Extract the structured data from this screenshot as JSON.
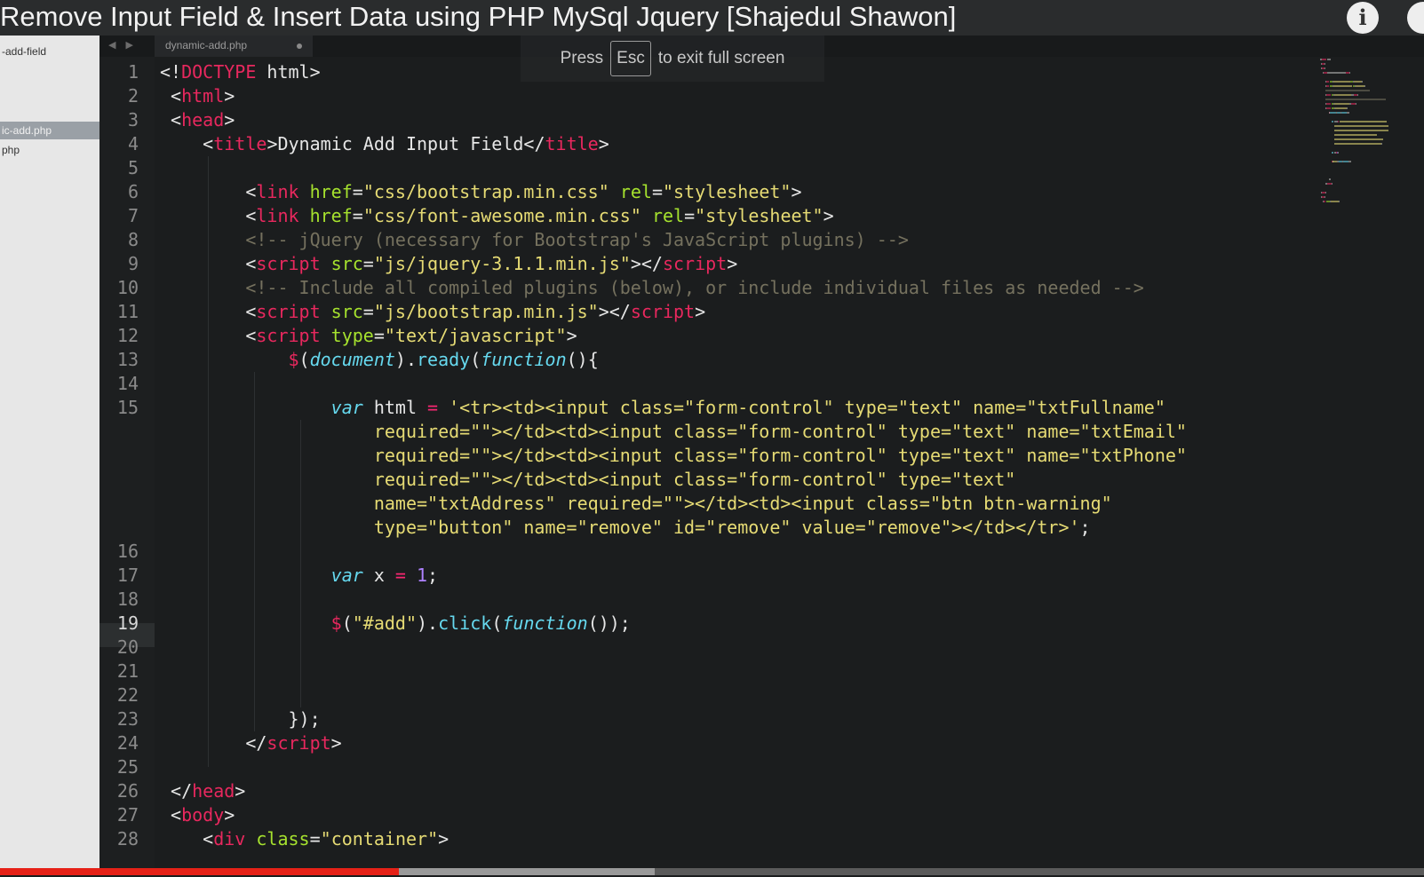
{
  "video": {
    "title": "Remove Input Field & Insert Data using PHP MySql Jquery [Shajedul Shawon]",
    "info_icon": "info-icon",
    "played_fraction": 0.28,
    "buffered_fraction": 0.46,
    "progress_color": "#e62117"
  },
  "fullscreen_toast": {
    "press": "Press",
    "key": "Esc",
    "rest": "to exit full screen"
  },
  "sidebar": {
    "items": [
      {
        "label": "-add-field",
        "selected": false
      },
      {
        "label": "ic-add.php",
        "selected": true
      },
      {
        "label": "php",
        "selected": false
      }
    ]
  },
  "editor": {
    "nav_arrows": "◀ ▶",
    "tab_label": "dynamic-add.php",
    "current_line": "19",
    "theme_colors": {
      "tag": "#e8285e",
      "string": "#e6db74",
      "attribute": "#a6e22e",
      "keyword": "#66d9ef",
      "comment": "#75715e"
    },
    "line_numbers": [
      "1",
      "2",
      "3",
      "4",
      "5",
      "6",
      "7",
      "8",
      "9",
      "10",
      "11",
      "12",
      "13",
      "14",
      "15",
      "",
      "",
      "",
      "",
      "",
      "16",
      "17",
      "18",
      "19",
      "20",
      "21",
      "22",
      "23",
      "24",
      "25",
      "26",
      "27",
      "28"
    ],
    "lines": [
      [
        {
          "t": "<!",
          "c": ""
        },
        {
          "t": "DOCTYPE",
          "c": "tag"
        },
        {
          "t": " html>",
          "c": ""
        }
      ],
      [
        {
          "t": " <",
          "c": ""
        },
        {
          "t": "html",
          "c": "tag"
        },
        {
          "t": ">",
          "c": ""
        }
      ],
      [
        {
          "t": " <",
          "c": ""
        },
        {
          "t": "head",
          "c": "tag"
        },
        {
          "t": ">",
          "c": ""
        }
      ],
      [
        {
          "t": "    <",
          "c": ""
        },
        {
          "t": "title",
          "c": "tag"
        },
        {
          "t": ">Dynamic Add Input Field</",
          "c": ""
        },
        {
          "t": "title",
          "c": "tag"
        },
        {
          "t": ">",
          "c": ""
        }
      ],
      [],
      [
        {
          "t": "        <",
          "c": ""
        },
        {
          "t": "link",
          "c": "tag"
        },
        {
          "t": " ",
          "c": ""
        },
        {
          "t": "href",
          "c": "attr"
        },
        {
          "t": "=",
          "c": ""
        },
        {
          "t": "\"css/bootstrap.min.css\"",
          "c": "str"
        },
        {
          "t": " ",
          "c": ""
        },
        {
          "t": "rel",
          "c": "attr"
        },
        {
          "t": "=",
          "c": ""
        },
        {
          "t": "\"stylesheet\"",
          "c": "str"
        },
        {
          "t": ">",
          "c": ""
        }
      ],
      [
        {
          "t": "        <",
          "c": ""
        },
        {
          "t": "link",
          "c": "tag"
        },
        {
          "t": " ",
          "c": ""
        },
        {
          "t": "href",
          "c": "attr"
        },
        {
          "t": "=",
          "c": ""
        },
        {
          "t": "\"css/font-awesome.min.css\"",
          "c": "str"
        },
        {
          "t": " ",
          "c": ""
        },
        {
          "t": "rel",
          "c": "attr"
        },
        {
          "t": "=",
          "c": ""
        },
        {
          "t": "\"stylesheet\"",
          "c": "str"
        },
        {
          "t": ">",
          "c": ""
        }
      ],
      [
        {
          "t": "        <!-- jQuery (necessary for Bootstrap's JavaScript plugins) -->",
          "c": "com"
        }
      ],
      [
        {
          "t": "        <",
          "c": ""
        },
        {
          "t": "script",
          "c": "tag"
        },
        {
          "t": " ",
          "c": ""
        },
        {
          "t": "src",
          "c": "attr"
        },
        {
          "t": "=",
          "c": ""
        },
        {
          "t": "\"js/jquery-3.1.1.min.js\"",
          "c": "str"
        },
        {
          "t": "></",
          "c": ""
        },
        {
          "t": "script",
          "c": "tag"
        },
        {
          "t": ">",
          "c": ""
        }
      ],
      [
        {
          "t": "        <!-- Include all compiled plugins (below), or include individual files as needed -->",
          "c": "com"
        }
      ],
      [
        {
          "t": "        <",
          "c": ""
        },
        {
          "t": "script",
          "c": "tag"
        },
        {
          "t": " ",
          "c": ""
        },
        {
          "t": "src",
          "c": "attr"
        },
        {
          "t": "=",
          "c": ""
        },
        {
          "t": "\"js/bootstrap.min.js\"",
          "c": "str"
        },
        {
          "t": "></",
          "c": ""
        },
        {
          "t": "script",
          "c": "tag"
        },
        {
          "t": ">",
          "c": ""
        }
      ],
      [
        {
          "t": "        <",
          "c": ""
        },
        {
          "t": "script",
          "c": "tag"
        },
        {
          "t": " ",
          "c": ""
        },
        {
          "t": "type",
          "c": "attr"
        },
        {
          "t": "=",
          "c": ""
        },
        {
          "t": "\"text/javascript\"",
          "c": "str"
        },
        {
          "t": ">",
          "c": ""
        }
      ],
      [
        {
          "t": "            ",
          "c": ""
        },
        {
          "t": "$",
          "c": "tag"
        },
        {
          "t": "(",
          "c": ""
        },
        {
          "t": "document",
          "c": "kw"
        },
        {
          "t": ").",
          "c": ""
        },
        {
          "t": "ready",
          "c": "fn"
        },
        {
          "t": "(",
          "c": ""
        },
        {
          "t": "function",
          "c": "kw"
        },
        {
          "t": "(){",
          "c": ""
        }
      ],
      [],
      [
        {
          "t": "                ",
          "c": ""
        },
        {
          "t": "var",
          "c": "kw"
        },
        {
          "t": " html ",
          "c": ""
        },
        {
          "t": "=",
          "c": "op"
        },
        {
          "t": " ",
          "c": ""
        },
        {
          "t": "'<tr><td><input class=\"form-control\" type=\"text\" name=\"txtFullname\"",
          "c": "str"
        }
      ],
      [
        {
          "t": "                    required=\"\"></td><td><input class=\"form-control\" type=\"text\" name=\"txtEmail\"",
          "c": "str"
        }
      ],
      [
        {
          "t": "                    required=\"\"></td><td><input class=\"form-control\" type=\"text\" name=\"txtPhone\"",
          "c": "str"
        }
      ],
      [
        {
          "t": "                    required=\"\"></td><td><input class=\"form-control\" type=\"text\"",
          "c": "str"
        }
      ],
      [
        {
          "t": "                    name=\"txtAddress\" required=\"\"></td><td><input class=\"btn btn-warning\"",
          "c": "str"
        }
      ],
      [
        {
          "t": "                    type=\"button\" name=\"remove\" id=\"remove\" value=\"remove\"></td></tr>'",
          "c": "str"
        },
        {
          "t": ";",
          "c": ""
        }
      ],
      [],
      [
        {
          "t": "                ",
          "c": ""
        },
        {
          "t": "var",
          "c": "kw"
        },
        {
          "t": " x ",
          "c": ""
        },
        {
          "t": "=",
          "c": "op"
        },
        {
          "t": " ",
          "c": ""
        },
        {
          "t": "1",
          "c": "num"
        },
        {
          "t": ";",
          "c": ""
        }
      ],
      [],
      [
        {
          "t": "                ",
          "c": ""
        },
        {
          "t": "$",
          "c": "tag"
        },
        {
          "t": "(",
          "c": ""
        },
        {
          "t": "\"#add\"",
          "c": "str"
        },
        {
          "t": ").",
          "c": ""
        },
        {
          "t": "click",
          "c": "fn"
        },
        {
          "t": "(",
          "c": ""
        },
        {
          "t": "function",
          "c": "kw"
        },
        {
          "t": "());",
          "c": ""
        }
      ],
      [],
      [],
      [],
      [
        {
          "t": "            });",
          "c": ""
        }
      ],
      [
        {
          "t": "        </",
          "c": ""
        },
        {
          "t": "script",
          "c": "tag"
        },
        {
          "t": ">",
          "c": ""
        }
      ],
      [],
      [
        {
          "t": " </",
          "c": ""
        },
        {
          "t": "head",
          "c": "tag"
        },
        {
          "t": ">",
          "c": ""
        }
      ],
      [
        {
          "t": " <",
          "c": ""
        },
        {
          "t": "body",
          "c": "tag"
        },
        {
          "t": ">",
          "c": ""
        }
      ],
      [
        {
          "t": "    <",
          "c": ""
        },
        {
          "t": "div",
          "c": "tag"
        },
        {
          "t": " ",
          "c": ""
        },
        {
          "t": "class",
          "c": "attr"
        },
        {
          "t": "=",
          "c": ""
        },
        {
          "t": "\"container\"",
          "c": "str"
        },
        {
          "t": ">",
          "c": ""
        }
      ]
    ]
  }
}
